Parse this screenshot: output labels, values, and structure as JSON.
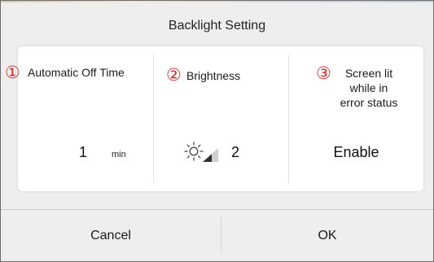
{
  "dialog": {
    "title": "Backlight Setting"
  },
  "settings": [
    {
      "badge": "①",
      "label": "Automatic Off Time",
      "value": "1",
      "unit": "min"
    },
    {
      "badge": "②",
      "label": "Brightness",
      "value": "2",
      "icon": "brightness-icon"
    },
    {
      "badge": "③",
      "label": "Screen lit\nwhile in\nerror status",
      "value": "Enable"
    }
  ],
  "buttons": {
    "cancel": "Cancel",
    "ok": "OK"
  },
  "colors": {
    "badge": "#e0252a",
    "panel": "#ffffff",
    "background": "#eeeeee"
  }
}
